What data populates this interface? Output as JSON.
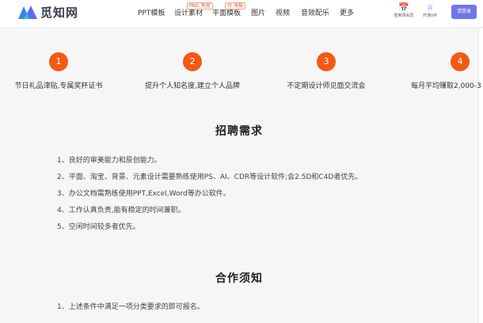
{
  "header": {
    "logo_text": "觅知网",
    "nav": [
      {
        "label": "PPT模板"
      },
      {
        "label": "设计素材",
        "tag": "PNG 免抠"
      },
      {
        "label": "平面模板",
        "tag": "付 海报"
      },
      {
        "label": "图片"
      },
      {
        "label": "视频"
      },
      {
        "label": "音效配乐"
      },
      {
        "label": "更多"
      }
    ],
    "signin_label": "签到领会员",
    "vip_label": "开通VIP",
    "login_label": "请登录",
    "colors": {
      "brand_blue": "#3b82f6",
      "brand_teal": "#35c1b0",
      "login": "#6e75e8"
    }
  },
  "benefits": [
    {
      "num": "1",
      "text": "节日礼品津贴,专属奖杯证书"
    },
    {
      "num": "2",
      "text": "提升个人知名度,建立个人品牌"
    },
    {
      "num": "3",
      "text": "不定期设计师见面交流会"
    },
    {
      "num": "4",
      "text": "每月平均赚取2,000-3"
    }
  ],
  "requirements": {
    "title": "招聘需求",
    "items": [
      "1、良好的审美能力和原创能力。",
      "2、平面、淘宝、背景、元素设计需要熟练使用PS、AI、CDR等设计软件;会2.5D和C4D者优先。",
      "3、办公文档需熟练使用PPT,Excel,Word等办公软件。",
      "4、工作认真负责,能有稳定的时间兼职。",
      "5、空闲时间较多者优先。"
    ]
  },
  "cooperation": {
    "title": "合作须知",
    "items": [
      "1、上述条件中满足一项分类要求的即可报名。"
    ]
  },
  "accent_color": "#f25a12"
}
